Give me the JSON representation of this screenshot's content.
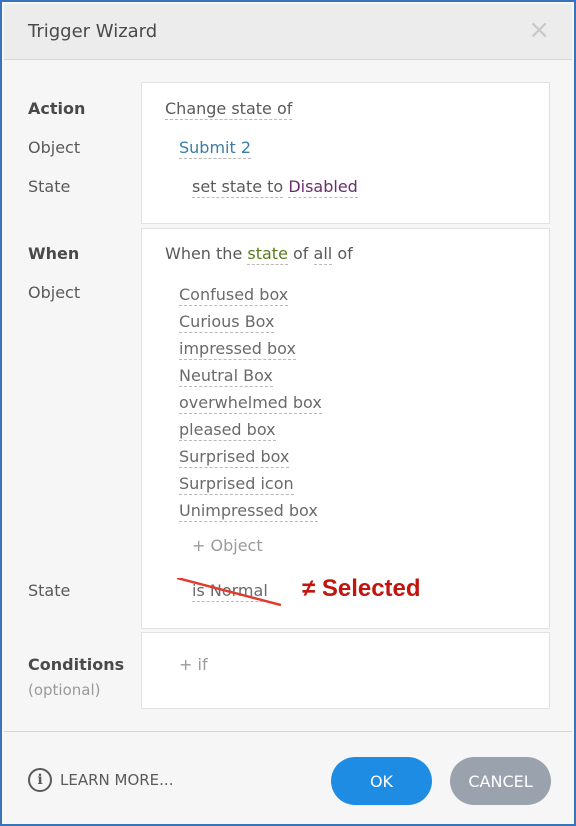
{
  "dialog": {
    "title": "Trigger Wizard",
    "close_glyph": "×"
  },
  "action_section": {
    "label": "Action",
    "object_label": "Object",
    "state_label": "State",
    "heading": "Change state of",
    "object": "Submit 2",
    "state_prefix": "set state to",
    "state_value": "Disabled"
  },
  "when_section": {
    "label": "When",
    "object_label": "Object",
    "state_label": "State",
    "heading_pre": "When the",
    "heading_state": "state",
    "heading_of": "of",
    "heading_all": "all",
    "heading_end": "of",
    "objects": [
      "Confused box",
      "Curious Box",
      "impressed box",
      "Neutral Box",
      "overwhelmed box",
      "pleased box",
      "Surprised box",
      "Surprised icon",
      "Unimpressed box"
    ],
    "add_object": "+ Object",
    "state_value": "is Normal",
    "annotation": "≠ Selected"
  },
  "conditions_section": {
    "label": "Conditions",
    "sublabel": "(optional)",
    "add_if": "+ if"
  },
  "footer": {
    "learn_more": "LEARN MORE...",
    "ok": "OK",
    "cancel": "CANCEL"
  },
  "colors": {
    "accent": "#1f8ce3",
    "frame_border": "#3a73b8",
    "annotation": "#c0160f",
    "cancel_button": "#9aa3ad"
  },
  "icons": [
    "close-icon",
    "info-icon"
  ]
}
